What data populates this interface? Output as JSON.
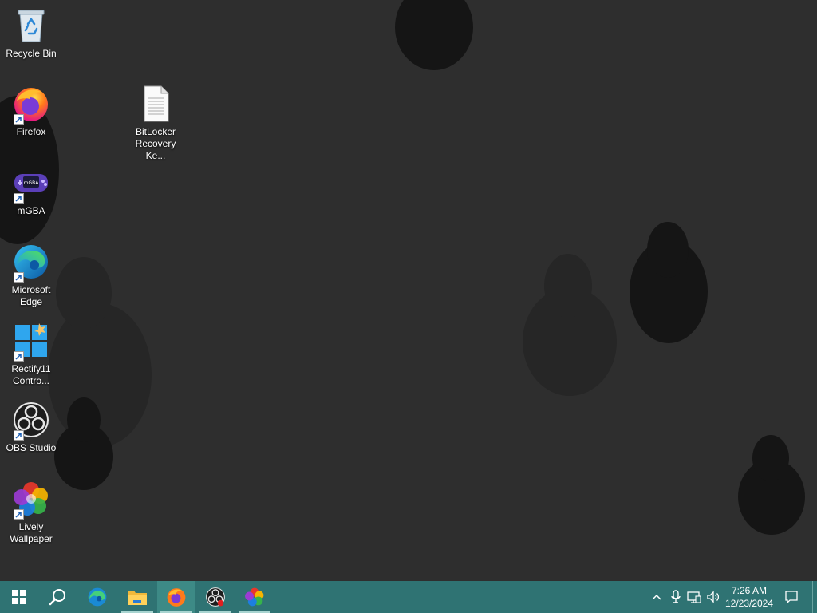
{
  "desktop": {
    "icons": [
      {
        "label": "Recycle Bin",
        "icon": "recycle-bin-icon",
        "shortcut": false
      },
      {
        "label": "Firefox",
        "icon": "firefox-icon",
        "shortcut": true
      },
      {
        "label": "mGBA",
        "icon": "mgba-icon",
        "shortcut": true
      },
      {
        "label": "Microsoft Edge",
        "icon": "edge-icon",
        "shortcut": true
      },
      {
        "label": "Rectify11 Contro...",
        "icon": "rectify11-icon",
        "shortcut": true
      },
      {
        "label": "OBS Studio",
        "icon": "obs-icon",
        "shortcut": true
      },
      {
        "label": "Lively Wallpaper",
        "icon": "lively-wallpaper-icon",
        "shortcut": true
      },
      {
        "label": "BitLocker Recovery Ke...",
        "icon": "text-document-icon",
        "shortcut": false
      }
    ]
  },
  "taskbar": {
    "pinned": [
      {
        "name": "start",
        "icon": "windows-start-icon"
      },
      {
        "name": "search",
        "icon": "search-icon"
      },
      {
        "name": "edge",
        "icon": "edge-icon"
      },
      {
        "name": "file-explorer",
        "icon": "folder-icon"
      },
      {
        "name": "firefox",
        "icon": "firefox-icon",
        "active": true
      },
      {
        "name": "obs-studio",
        "icon": "obs-icon",
        "running": true
      },
      {
        "name": "lively-wallpaper",
        "icon": "lively-wallpaper-icon",
        "running": true
      }
    ],
    "tray": {
      "icons": [
        "chevron-up-icon",
        "microphone-icon",
        "network-icon",
        "volume-icon"
      ],
      "time": "7:26 AM",
      "date": "12/23/2024"
    }
  },
  "colors": {
    "desktop_background": "#2e2e2e",
    "taskbar": "#2f7373",
    "taskbar_active": "#3d8a86"
  }
}
